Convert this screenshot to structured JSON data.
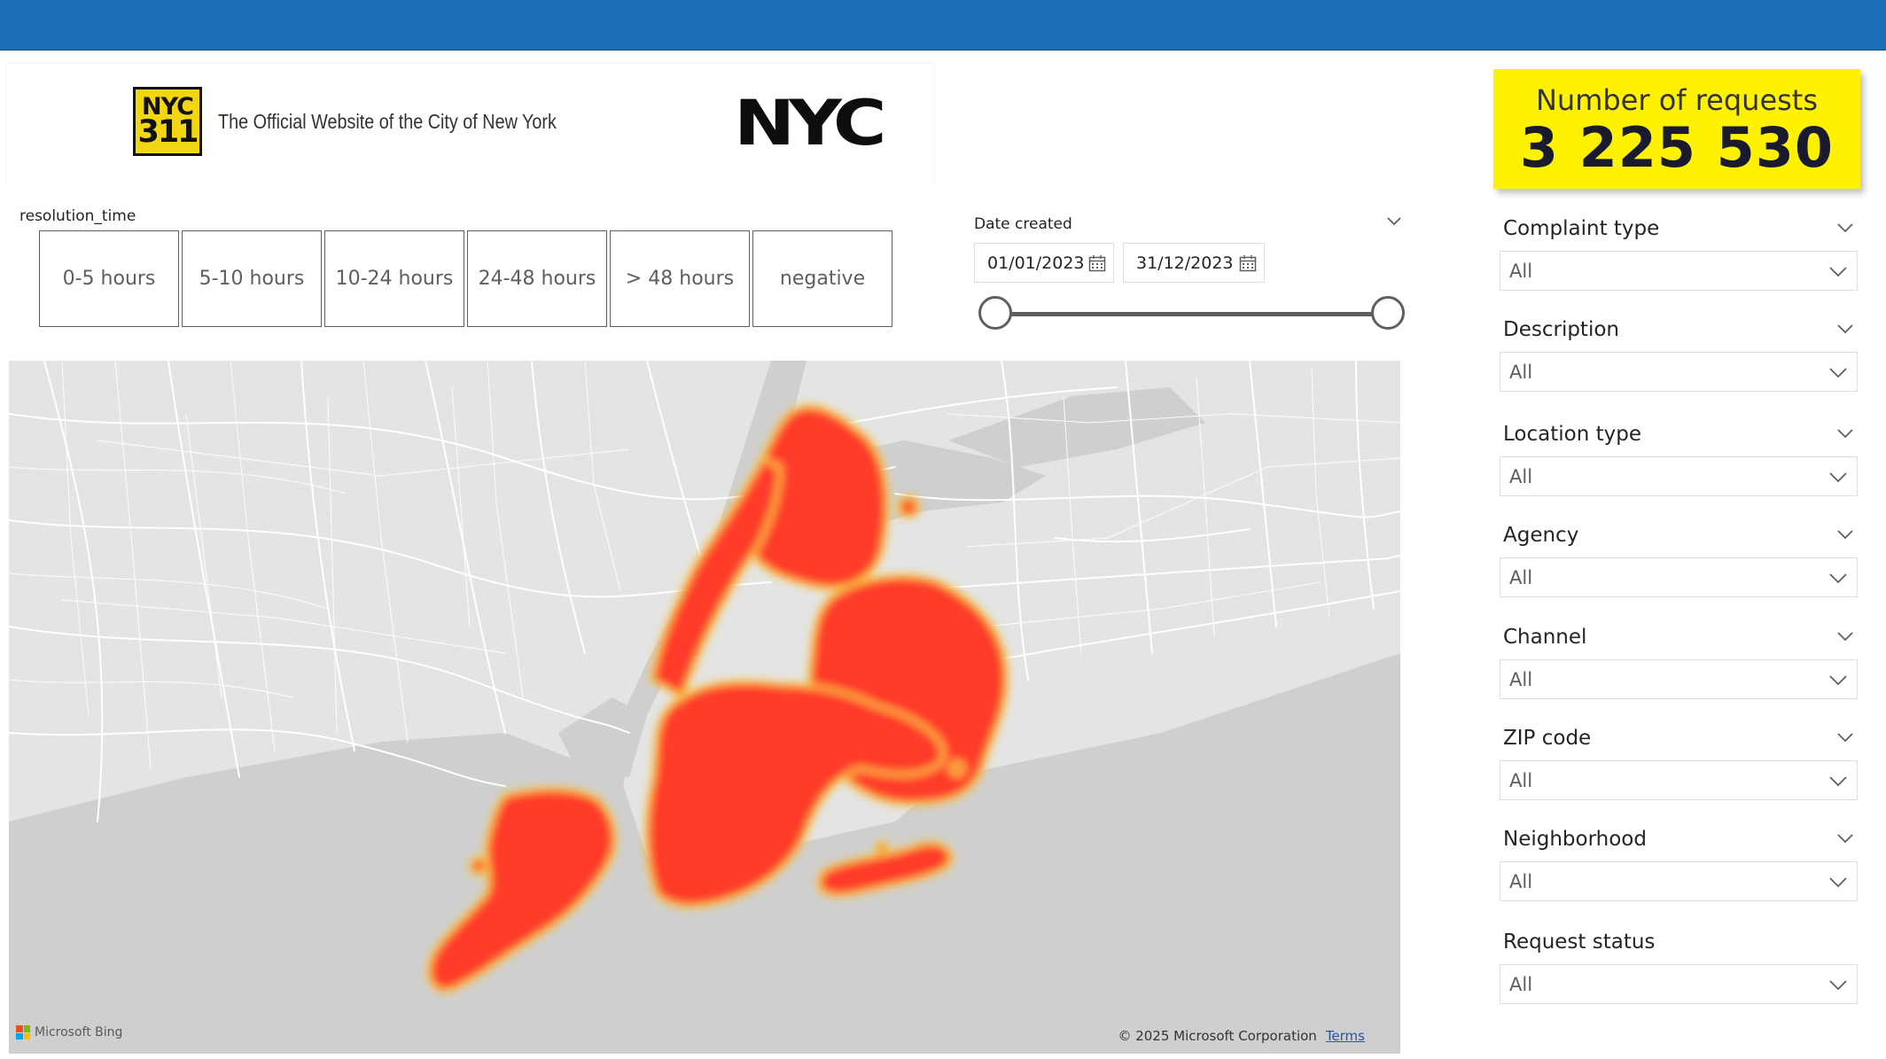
{
  "header": {
    "logo_311_line1": "NYC",
    "logo_311_line2": "311",
    "official_site_text": "The Official Website of the City of New York",
    "nyc_logo_text": "NYC"
  },
  "resolution_slicer": {
    "title": "resolution_time",
    "options": [
      "0-5 hours",
      "5-10 hours",
      "10-24 hours",
      "24-48 hours",
      "> 48 hours",
      "negative"
    ]
  },
  "date_slicer": {
    "title": "Date created",
    "start": "01/01/2023",
    "end": "31/12/2023",
    "range_fraction": [
      0,
      1
    ]
  },
  "kpi": {
    "label": "Number of requests",
    "value": "3 225 530",
    "background_color": "#fff200"
  },
  "filters": [
    {
      "title": "Complaint type",
      "value": "All"
    },
    {
      "title": "Description",
      "value": "All"
    },
    {
      "title": "Location type",
      "value": "All"
    },
    {
      "title": "Agency",
      "value": "All"
    },
    {
      "title": "Channel",
      "value": "All"
    },
    {
      "title": "ZIP code",
      "value": "All"
    },
    {
      "title": "Neighborhood",
      "value": "All"
    },
    {
      "title": "Request status",
      "value": "All"
    }
  ],
  "map": {
    "provider_label": "Microsoft Bing",
    "copyright": "© 2025 Microsoft Corporation",
    "terms_link": "Terms",
    "heatmap_color": "#ff3a2c"
  },
  "colors": {
    "header_bar": "#1b6fb5",
    "accent_yellow": "#fff200"
  }
}
